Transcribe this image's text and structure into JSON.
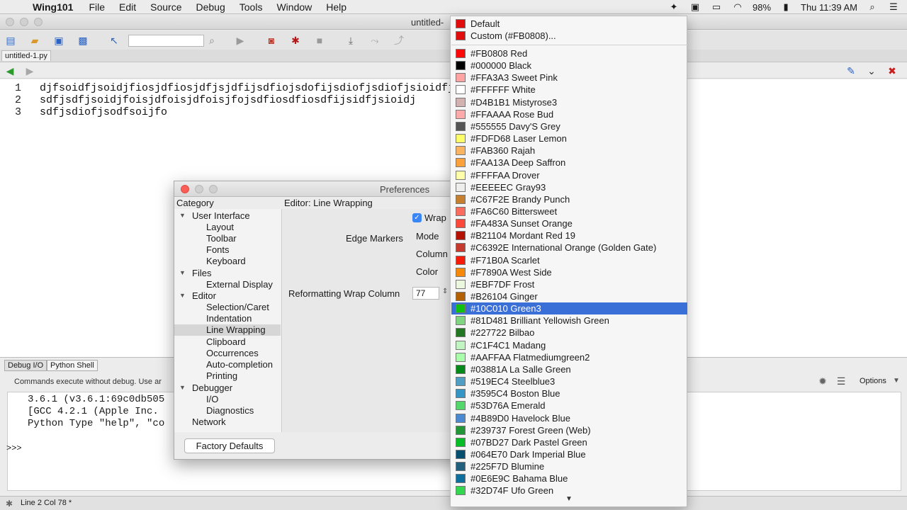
{
  "menubar": {
    "app_name": "Wing101",
    "items": [
      "File",
      "Edit",
      "Source",
      "Debug",
      "Tools",
      "Window",
      "Help"
    ],
    "battery": "98%",
    "clock": "Thu 11:39 AM"
  },
  "window": {
    "title": "untitled-"
  },
  "editor": {
    "file_tab": "untitled-1.py",
    "lines": [
      {
        "num": "1",
        "text": "djfsoidfjsoidjfiosjdfiosjdfjsjdfijsdfiojsdofijsdiofjsdiofjsioidfjs"
      },
      {
        "num": "2",
        "text": "sdfjsdfjsoidjfoisjdfoisjdfoisjfojsdfiosdfiosdfijsidfjsioidj"
      },
      {
        "num": "3",
        "text": "sdfjsdiofjsodfsoijfo"
      }
    ]
  },
  "bottom": {
    "tabs": [
      "Debug I/O",
      "Python Shell"
    ],
    "note": "Commands execute without debug.  Use ar",
    "shell_lines": [
      "3.6.1 (v3.6.1:69c0db505",
      "[GCC 4.2.1 (Apple Inc.",
      "Python Type \"help\", \"co"
    ],
    "prompt": ">>>",
    "options_label": "Options",
    "status": "Line 2 Col 78 *"
  },
  "prefs": {
    "title": "Preferences",
    "category_header": "Category",
    "panel_header": "Editor: Line Wrapping",
    "tree": [
      {
        "label": "User Interface",
        "level": 0,
        "expanded": true
      },
      {
        "label": "Layout",
        "level": 1
      },
      {
        "label": "Toolbar",
        "level": 1
      },
      {
        "label": "Fonts",
        "level": 1
      },
      {
        "label": "Keyboard",
        "level": 1
      },
      {
        "label": "Files",
        "level": 0,
        "expanded": true
      },
      {
        "label": "External Display",
        "level": 1
      },
      {
        "label": "Editor",
        "level": 0,
        "expanded": true
      },
      {
        "label": "Selection/Caret",
        "level": 1
      },
      {
        "label": "Indentation",
        "level": 1
      },
      {
        "label": "Line Wrapping",
        "level": 1,
        "selected": true
      },
      {
        "label": "Clipboard",
        "level": 1
      },
      {
        "label": "Occurrences",
        "level": 1
      },
      {
        "label": "Auto-completion",
        "level": 1
      },
      {
        "label": "Printing",
        "level": 1
      },
      {
        "label": "Debugger",
        "level": 0,
        "expanded": true
      },
      {
        "label": "I/O",
        "level": 1
      },
      {
        "label": "Diagnostics",
        "level": 1
      },
      {
        "label": "Network",
        "level": 0
      }
    ],
    "wrap_label": "Wrap",
    "wrap_checked": true,
    "edge_markers_label": "Edge Markers",
    "mode_label": "Mode",
    "column_label": "Column",
    "color_label": "Color",
    "reformat_label": "Reformatting Wrap Column",
    "reformat_value": "77",
    "factory_button": "Factory Defaults"
  },
  "color_menu": {
    "selected": "#10C010 Green3",
    "items": [
      {
        "label": "Default",
        "color": "#E10C0C"
      },
      {
        "label": "Custom (#FB0808)...",
        "color": "#E10C0C"
      },
      {
        "label": "#FB0808 Red",
        "color": "#FB0808"
      },
      {
        "label": "#000000 Black",
        "color": "#000000"
      },
      {
        "label": "#FFA3A3 Sweet Pink",
        "color": "#FFA3A3"
      },
      {
        "label": "#FFFFFF White",
        "color": "#FFFFFF"
      },
      {
        "label": "#D4B1B1 Mistyrose3",
        "color": "#D4B1B1"
      },
      {
        "label": "#FFAAAA Rose Bud",
        "color": "#FFAAAA"
      },
      {
        "label": "#555555 Davy'S Grey",
        "color": "#555555"
      },
      {
        "label": "#FDFD68 Laser Lemon",
        "color": "#FDFD68"
      },
      {
        "label": "#FAB360 Rajah",
        "color": "#FAB360"
      },
      {
        "label": "#FAA13A Deep Saffron",
        "color": "#FAA13A"
      },
      {
        "label": "#FFFFAA Drover",
        "color": "#FFFFAA"
      },
      {
        "label": "#EEEEEC Gray93",
        "color": "#EEEEEC"
      },
      {
        "label": "#C67F2E Brandy Punch",
        "color": "#C67F2E"
      },
      {
        "label": "#FA6C60 Bittersweet",
        "color": "#FA6C60"
      },
      {
        "label": "#FA483A Sunset Orange",
        "color": "#FA483A"
      },
      {
        "label": "#B21104 Mordant Red 19",
        "color": "#B21104"
      },
      {
        "label": "#C6392E International Orange (Golden Gate)",
        "color": "#C6392E"
      },
      {
        "label": "#F71B0A Scarlet",
        "color": "#F71B0A"
      },
      {
        "label": "#F7890A West Side",
        "color": "#F7890A"
      },
      {
        "label": "#EBF7DF Frost",
        "color": "#EBF7DF"
      },
      {
        "label": "#B26104 Ginger",
        "color": "#B26104"
      },
      {
        "label": "#10C010 Green3",
        "color": "#10C010"
      },
      {
        "label": "#81D481 Brilliant Yellowish Green",
        "color": "#81D481"
      },
      {
        "label": "#227722 Bilbao",
        "color": "#227722"
      },
      {
        "label": "#C1F4C1 Madang",
        "color": "#C1F4C1"
      },
      {
        "label": "#AAFFAA Flatmediumgreen2",
        "color": "#AAFFAA"
      },
      {
        "label": "#03881A La Salle Green",
        "color": "#03881A"
      },
      {
        "label": "#519EC4 Steelblue3",
        "color": "#519EC4"
      },
      {
        "label": "#3595C4 Boston Blue",
        "color": "#3595C4"
      },
      {
        "label": "#53D76A Emerald",
        "color": "#53D76A"
      },
      {
        "label": "#4B89D0 Havelock Blue",
        "color": "#4B89D0"
      },
      {
        "label": "#239737 Forest Green (Web)",
        "color": "#239737"
      },
      {
        "label": "#07BD27 Dark Pastel Green",
        "color": "#07BD27"
      },
      {
        "label": "#064E70 Dark Imperial Blue",
        "color": "#064E70"
      },
      {
        "label": "#225F7D Blumine",
        "color": "#225F7D"
      },
      {
        "label": "#0E6E9C Bahama Blue",
        "color": "#0E6E9C"
      },
      {
        "label": "#32D74F Ufo Green",
        "color": "#32D74F"
      }
    ]
  },
  "icons": {
    "apple": "",
    "more_down": "▼"
  }
}
